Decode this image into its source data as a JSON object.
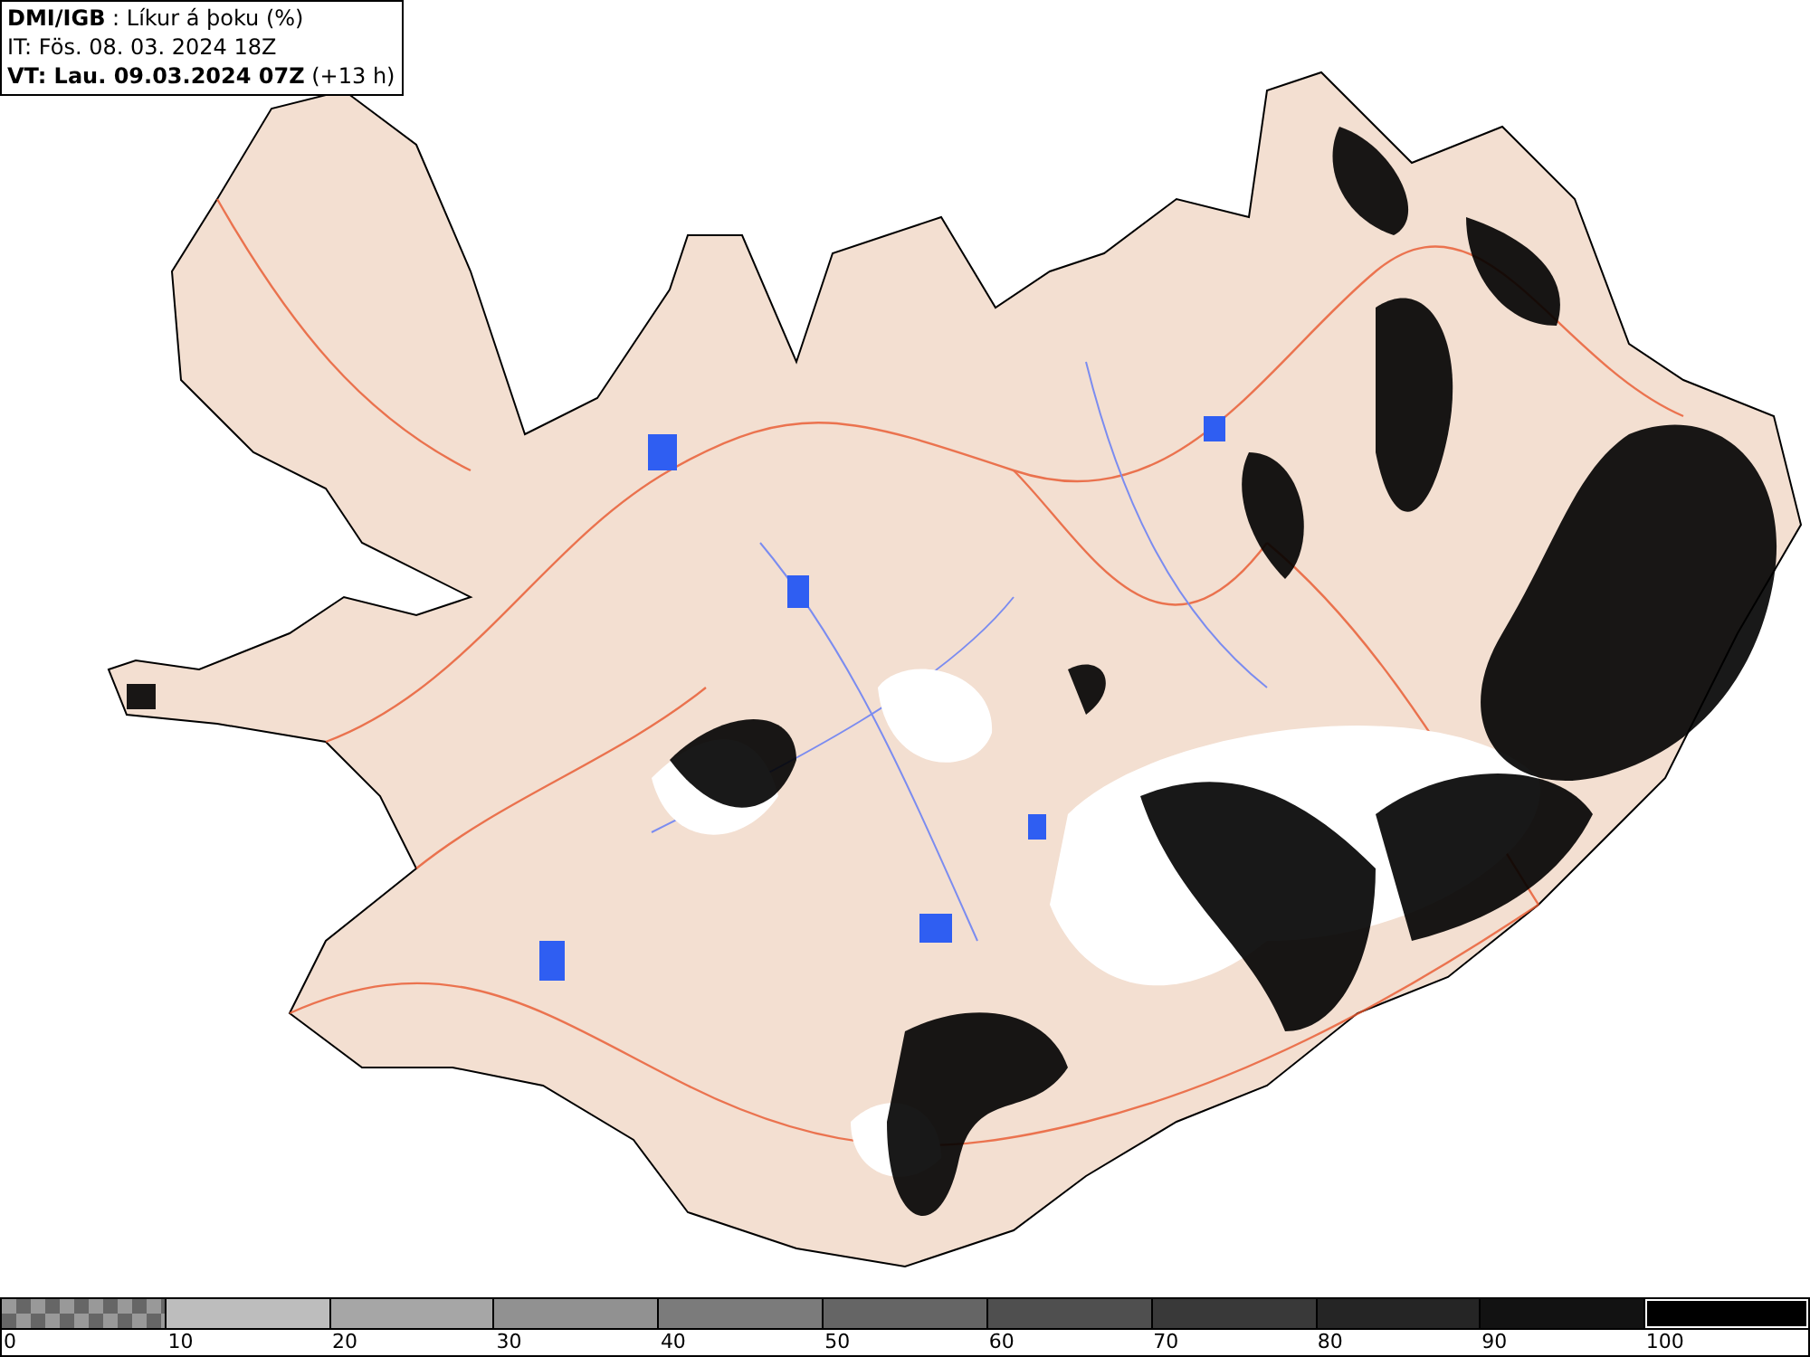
{
  "header": {
    "lines": [
      "**DMI/IGB** : Líkur á þoku (%)",
      "IT: Fös. 08. 03. 2024 18Z",
      "**VT: Lau. 09.03.2024 07Z** (+13 h)"
    ]
  },
  "legend": {
    "segments": [
      {
        "kind": "checker",
        "label": "0"
      },
      {
        "kind": "solid",
        "color": "#bdbdbd",
        "label": "10"
      },
      {
        "kind": "solid",
        "color": "#a6a6a6",
        "label": "20"
      },
      {
        "kind": "solid",
        "color": "#919191",
        "label": "30"
      },
      {
        "kind": "solid",
        "color": "#7b7b7b",
        "label": "40"
      },
      {
        "kind": "solid",
        "color": "#656565",
        "label": "50"
      },
      {
        "kind": "solid",
        "color": "#4f4f4f",
        "label": "60"
      },
      {
        "kind": "solid",
        "color": "#393939",
        "label": "70"
      },
      {
        "kind": "solid",
        "color": "#252525",
        "label": "80"
      },
      {
        "kind": "solid",
        "color": "#121212",
        "label": "90"
      },
      {
        "kind": "solid",
        "color": "#000000",
        "label": "100"
      }
    ]
  }
}
